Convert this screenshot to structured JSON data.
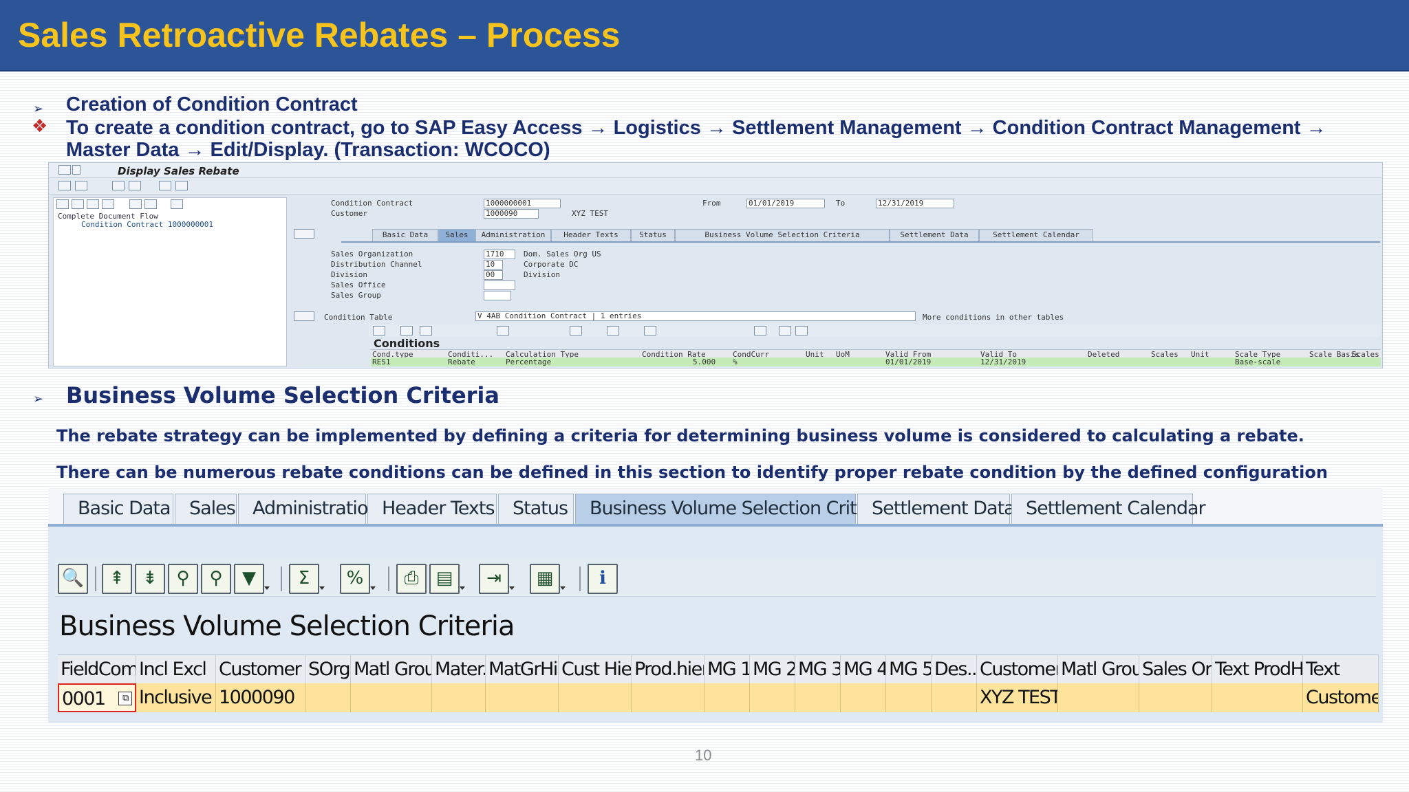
{
  "slide": {
    "title": "Sales Retroactive Rebates – Process",
    "page_number": "10"
  },
  "section1": {
    "heading": "Creation of Condition Contract",
    "bullet_line1": "To create a condition contract, go to SAP Easy Access → Logistics → Settlement Management → Condition Contract Management →",
    "bullet_line2": "Master Data → Edit/Display. (Transaction: WCOCO)"
  },
  "shot1": {
    "window_title": "Display Sales Rebate",
    "tree_root": "Complete Document Flow",
    "tree_item": "Condition Contract 1000000001",
    "condition_contract_label": "Condition Contract",
    "condition_contract_value": "1000000001",
    "customer_label": "Customer",
    "customer_value": "1000090",
    "customer_name": "XYZ TEST",
    "from_label": "From",
    "from_value": "01/01/2019",
    "to_label": "To",
    "to_value": "12/31/2019",
    "tabs": [
      "Basic Data",
      "Sales",
      "Administration",
      "Header Texts",
      "Status",
      "Business Volume Selection Criteria",
      "Settlement Data",
      "Settlement Calendar"
    ],
    "active_tab": "Sales",
    "sales_org_label": "Sales Organization",
    "sales_org_value": "1710",
    "sales_org_text": "Dom. Sales Org US",
    "dist_channel_label": "Distribution Channel",
    "dist_channel_value": "10",
    "dist_channel_text": "Corporate DC",
    "division_label": "Division",
    "division_value": "00",
    "division_text": "Division",
    "sales_office_label": "Sales Office",
    "sales_group_label": "Sales Group",
    "condition_table_label": "Condition Table",
    "condition_table_value": "V 4AB Condition Contract | 1 entries",
    "more_conditions": "More conditions in other tables",
    "conditions_title": "Conditions",
    "grid_headers": [
      "Cond.type",
      "Conditi...",
      "Calculation Type",
      "Condition Rate",
      "CondCurr",
      "Unit",
      "UoM",
      "Valid From",
      "Valid To",
      "Deleted",
      "Scales",
      "Unit",
      "Scale Type",
      "Scale Basis",
      "Scales"
    ],
    "grid_row": [
      "RES1",
      "Rebate",
      "Percentage",
      "5.000",
      "%",
      "",
      "",
      "01/01/2019",
      "12/31/2019",
      "",
      "",
      "",
      "Base-scale",
      "",
      ""
    ]
  },
  "section2": {
    "heading": "Business Volume Selection Criteria",
    "para1": "The rebate strategy can be implemented by defining a criteria for determining business volume is considered to calculating a rebate.",
    "para2": "There can be numerous rebate conditions can be defined in this section to identify proper rebate condition by the defined configuration"
  },
  "shot2": {
    "tabs": [
      "Basic Data",
      "Sales",
      "Administration",
      "Header Texts",
      "Status",
      "Business Volume Selection Criteria",
      "Settlement Data",
      "Settlement Calendar"
    ],
    "active_tab": "Business Volume Selection Criteria",
    "panel_title": "Business Volume Selection Criteria",
    "toolbar_icons": [
      "details-icon",
      "first-row-icon",
      "last-row-icon",
      "find-icon",
      "find-next-icon",
      "filter-icon",
      "sum-icon",
      "subtotal-icon",
      "print-icon",
      "views-icon",
      "export-icon",
      "layout-icon",
      "info-icon"
    ],
    "columns": [
      "FieldComb.",
      "Incl Excl",
      "Customer",
      "SOrg.",
      "Matl Group",
      "Mater...",
      "MatGrHier",
      "Cust Hier",
      "Prod.hier.",
      "MG 1",
      "MG 2",
      "MG 3",
      "MG 4",
      "MG 5",
      "Des...",
      "Customer",
      "Matl Group",
      "Sales Or...",
      "Text ProdH",
      "Text"
    ],
    "row": [
      "0001",
      "Inclusive",
      "1000090",
      "",
      "",
      "",
      "",
      "",
      "",
      "",
      "",
      "",
      "",
      "",
      "",
      "XYZ TEST",
      "",
      "",
      "",
      "Customer"
    ]
  },
  "colors": {
    "title_bar": "#2b5597",
    "title_text": "#f7c31d",
    "body_text": "#1a2d6e",
    "selected_row": "#fde39b",
    "condition_row": "#c5ecb8"
  }
}
